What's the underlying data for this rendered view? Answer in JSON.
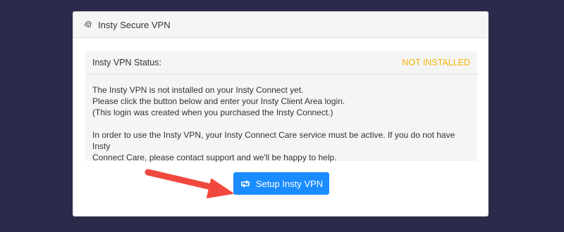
{
  "card": {
    "title": "Insty Secure VPN",
    "title_icon": "fingerprint-icon"
  },
  "status": {
    "label": "Insty VPN Status:",
    "value": "NOT INSTALLED",
    "value_color": "#f5b400"
  },
  "message": {
    "lines": [
      "The Insty VPN is not installed on your Insty Connect yet.",
      "Please click the button below and enter your Insty Client Area login.",
      "(This login was created when you purchased the Insty Connect.)"
    ],
    "care_line_1": "In order to use the Insty VPN, your Insty Connect Care service must be active. If you do not have Insty",
    "care_line_2": "Connect Care, please contact support and we'll be happy to help."
  },
  "button": {
    "label": "Setup Insty VPN",
    "icon": "retweet-icon",
    "color": "#1a8cff"
  },
  "annotation": {
    "arrow_color": "#f0483e"
  }
}
